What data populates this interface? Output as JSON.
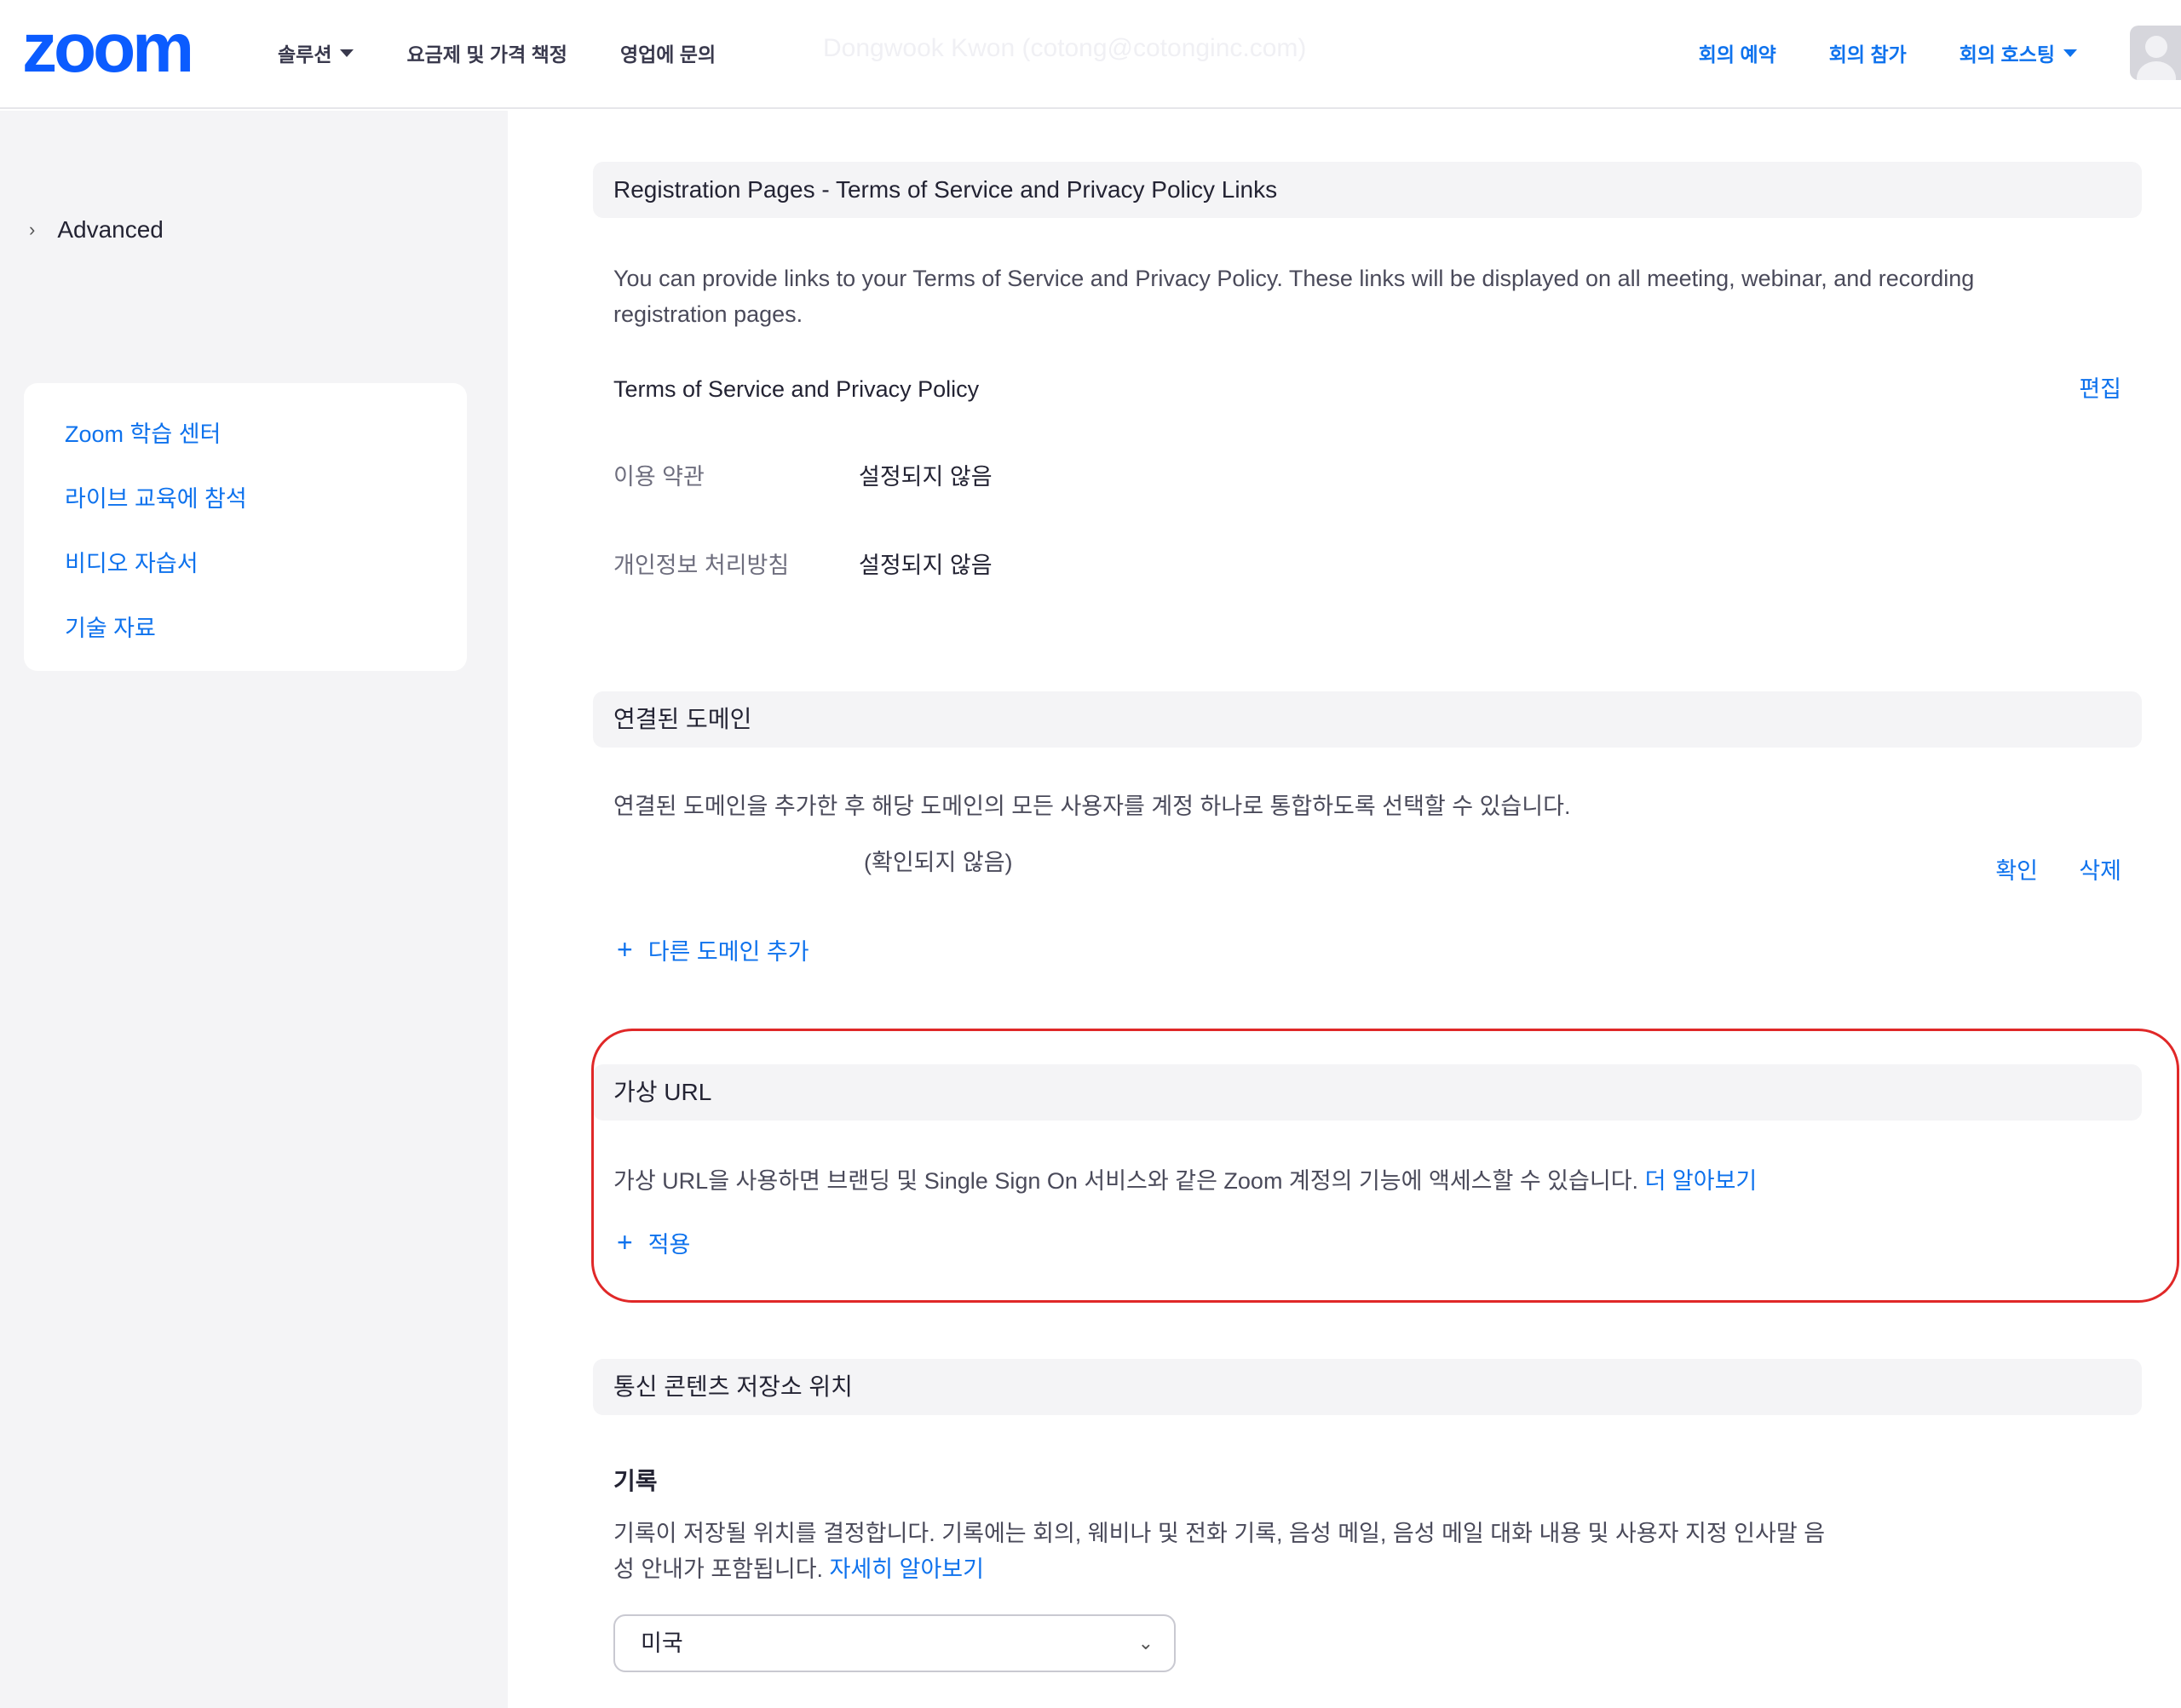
{
  "header": {
    "logo_text": "zoom",
    "nav_left": [
      {
        "label": "솔루션",
        "dropdown": true
      },
      {
        "label": "요금제 및 가격 책정",
        "dropdown": false
      },
      {
        "label": "영업에 문의",
        "dropdown": false
      }
    ],
    "faded_user": "Dongwook Kwon (cotong@cotonginc.com)",
    "nav_right": [
      {
        "label": "회의 예약"
      },
      {
        "label": "회의 참가"
      },
      {
        "label": "회의 호스팅"
      }
    ]
  },
  "sidebar": {
    "advanced_label": "Advanced",
    "learn_links": [
      "Zoom 학습 센터",
      "라이브 교육에 참석",
      "비디오 자습서",
      "기술 자료"
    ]
  },
  "registration": {
    "title": "Registration Pages - Terms of Service and Privacy Policy Links",
    "description_line1": "You can provide links to your Terms of Service and Privacy Policy. These links will be displayed on all meeting, webinar, and recording",
    "description_line2": "registration pages.",
    "tos_heading": "Terms of Service and Privacy Policy",
    "edit_label": "편집",
    "rows": [
      {
        "label": "이용 약관",
        "value": "설정되지 않음"
      },
      {
        "label": "개인정보 처리방침",
        "value": "설정되지 않음"
      }
    ]
  },
  "domains": {
    "title": "연결된 도메인",
    "description": "연결된 도메인을 추가한 후 해당 도메인의 모든 사용자를 계정 하나로 통합하도록 선택할 수 있습니다.",
    "status": "(확인되지 않음)",
    "verify_label": "확인",
    "delete_label": "삭제",
    "add_label": "다른 도메인 추가"
  },
  "vanity": {
    "title": "가상 URL",
    "description": "가상 URL을 사용하면 브랜딩 및 Single Sign On 서비스와 같은 Zoom 계정의 기능에 액세스할 수 있습니다.",
    "learn_more": "더 알아보기",
    "apply_label": "적용"
  },
  "storage": {
    "title": "통신 콘텐츠 저장소 위치",
    "subhead": "기록",
    "description_line1": "기록이 저장될 위치를 결정합니다. 기록에는 회의, 웨비나 및 전화 기록, 음성 메일, 음성 메일 대화 내용 및 사용자 지정 인사말 음",
    "description_line2": "성 안내가 포함됩니다.",
    "learn_more": "자세히 알아보기",
    "region_selected": "미국"
  },
  "colors": {
    "brand_blue": "#0e72ed",
    "highlight_red": "#e02828",
    "panel_gray": "#f4f4f6"
  }
}
